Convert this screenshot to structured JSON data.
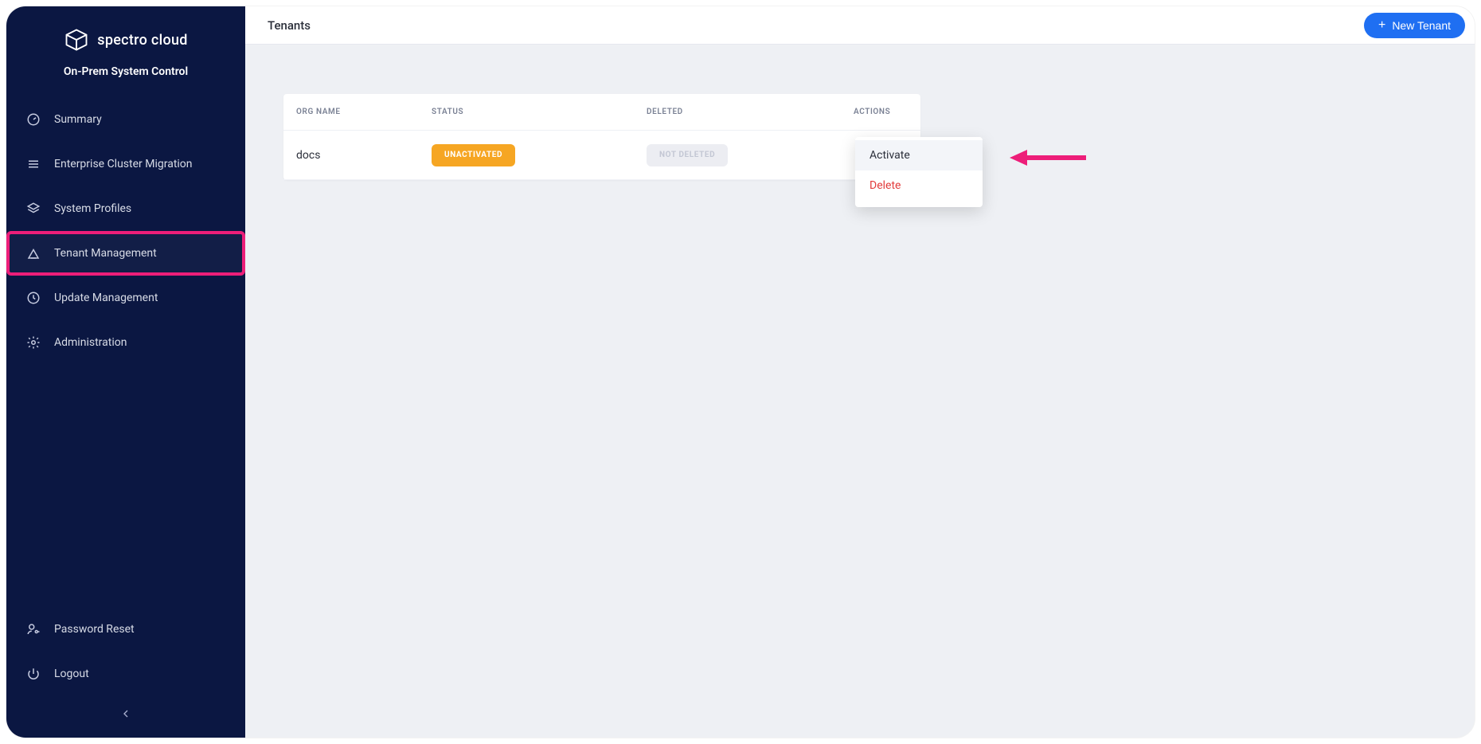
{
  "brand": {
    "name": "spectro cloud",
    "subtitle": "On-Prem System Control"
  },
  "sidebar": {
    "items": [
      {
        "label": "Summary"
      },
      {
        "label": "Enterprise Cluster Migration"
      },
      {
        "label": "System Profiles"
      },
      {
        "label": "Tenant Management"
      },
      {
        "label": "Update Management"
      },
      {
        "label": "Administration"
      }
    ],
    "bottom": [
      {
        "label": "Password Reset"
      },
      {
        "label": "Logout"
      }
    ]
  },
  "header": {
    "title": "Tenants",
    "new_button": "New Tenant"
  },
  "table": {
    "columns": {
      "org": "ORG NAME",
      "status": "STATUS",
      "deleted": "DELETED",
      "actions": "ACTIONS"
    },
    "rows": [
      {
        "org": "docs",
        "status": "UNACTIVATED",
        "deleted": "NOT DELETED"
      }
    ]
  },
  "menu": {
    "activate": "Activate",
    "delete": "Delete"
  }
}
